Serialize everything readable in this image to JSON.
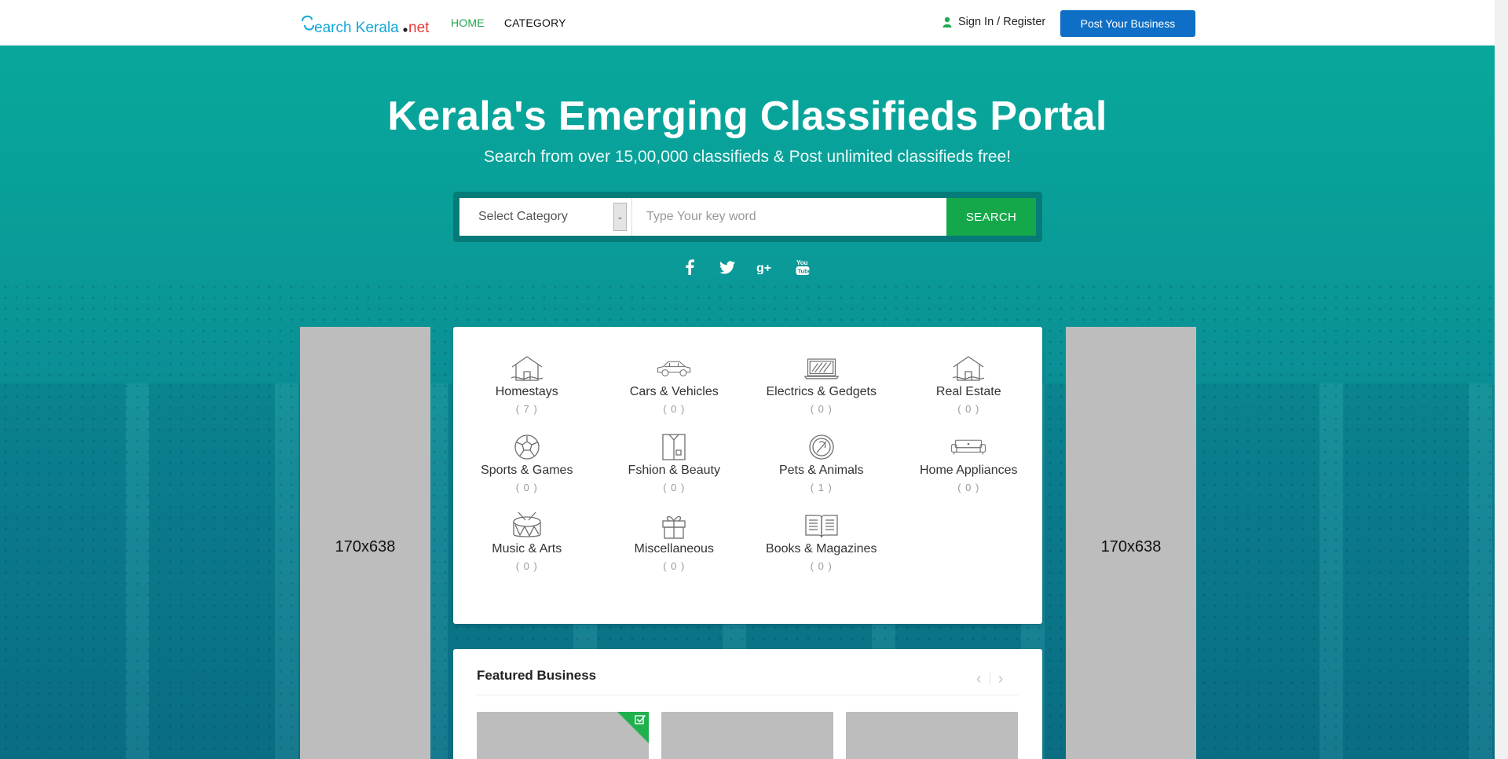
{
  "header": {
    "logo_text_main": "Search Kerala",
    "logo_text_tld": ".net",
    "nav": [
      {
        "label": "HOME",
        "active": true
      },
      {
        "label": "CATEGORY",
        "active": false
      }
    ],
    "signin_label": "Sign In / Register",
    "post_button": "Post Your Business"
  },
  "hero": {
    "title": "Kerala's Emerging Classifieds Portal",
    "subtitle": "Search from over 15,00,000 classifieds & Post unlimited classifieds free!"
  },
  "search": {
    "category_selected": "Select Category",
    "keyword_placeholder": "Type Your key word",
    "button_label": "SEARCH"
  },
  "socials": [
    "facebook-icon",
    "twitter-icon",
    "google-plus-icon",
    "youtube-icon"
  ],
  "ads": {
    "left_label": "170x638",
    "right_label": "170x638"
  },
  "categories": [
    {
      "name": "Homestays",
      "count": "( 7 )",
      "icon": "house-icon"
    },
    {
      "name": "Cars & Vehicles",
      "count": "( 0 )",
      "icon": "car-icon"
    },
    {
      "name": "Electrics & Gedgets",
      "count": "( 0 )",
      "icon": "laptop-icon"
    },
    {
      "name": "Real Estate",
      "count": "( 0 )",
      "icon": "house-icon"
    },
    {
      "name": "Sports & Games",
      "count": "( 0 )",
      "icon": "soccer-ball-icon"
    },
    {
      "name": "Fshion & Beauty",
      "count": "( 0 )",
      "icon": "shirt-icon"
    },
    {
      "name": "Pets & Animals",
      "count": "( 1 )",
      "icon": "pet-icon"
    },
    {
      "name": "Home Appliances",
      "count": "( 0 )",
      "icon": "sofa-icon"
    },
    {
      "name": "Music & Arts",
      "count": "( 0 )",
      "icon": "drum-icon"
    },
    {
      "name": "Miscellaneous",
      "count": "( 0 )",
      "icon": "gift-icon"
    },
    {
      "name": "Books & Magazines",
      "count": "( 0 )",
      "icon": "book-icon"
    }
  ],
  "featured": {
    "title": "Featured Business"
  },
  "colors": {
    "brand_green": "#22a84f",
    "post_button_blue": "#0f6fc6",
    "search_button_green": "#14a84b",
    "hero_teal": "#07a89b"
  }
}
